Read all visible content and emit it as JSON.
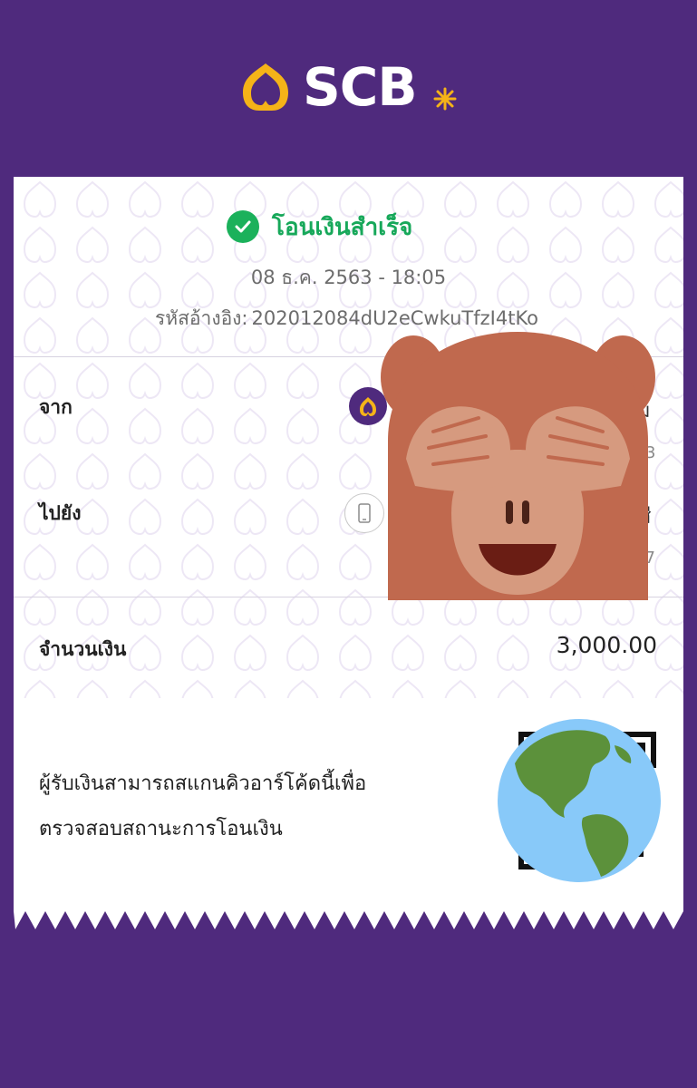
{
  "brand": {
    "name": "SCB",
    "colors": {
      "purple": "#4f2a7d",
      "gold": "#f5b318",
      "green": "#17a85a"
    },
    "logo_icon": "scb-lotus-logo-icon",
    "star_icon": "asterisk-star-icon"
  },
  "status": {
    "text": "โอนเงินสำเร็จ",
    "icon": "check-circle-icon"
  },
  "transaction": {
    "datetime": "08 ธ.ค. 2563 - 18:05",
    "ref_label": "รหัสอ้างอิง:",
    "ref_value": "202012084dU2eCwkuTfzI4tKo"
  },
  "from": {
    "label": "จาก",
    "icon": "scb-bank-icon",
    "name_partial": "ม",
    "account_partial": "3"
  },
  "to": {
    "label": "ไปยัง",
    "icon": "mobile-phone-icon",
    "name_partial": "สี",
    "account_partial": "97"
  },
  "amount": {
    "label": "จำนวนเงิน",
    "value": "3,000.00"
  },
  "qr": {
    "note_line1": "ผู้รับเงินสามารถสแกนคิวอาร์โค้ดนี้เพื่อ",
    "note_line2": "ตรวจสอบสถานะการโอนเงิน",
    "icon": "qr-code-icon"
  },
  "overlays": {
    "monkey": "see-no-evil-monkey-emoji-icon",
    "globe": "globe-americas-emoji-icon"
  }
}
